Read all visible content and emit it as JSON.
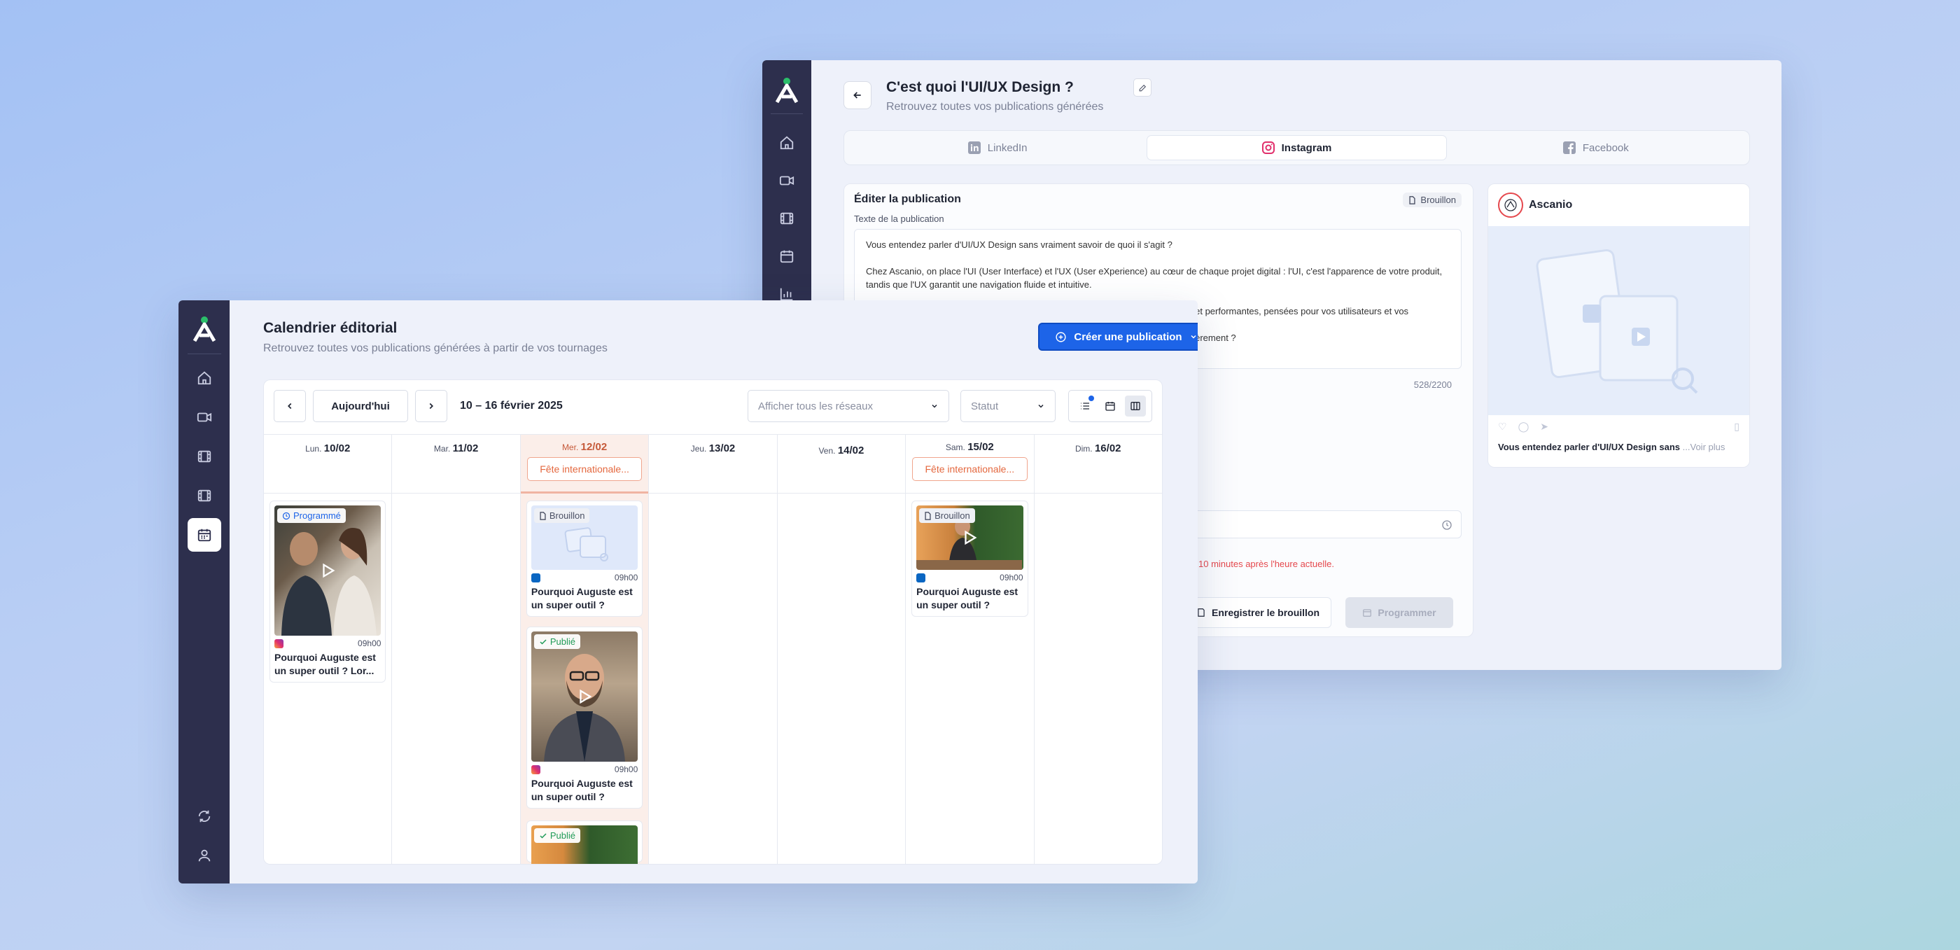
{
  "back": {
    "header_title": "C'est quoi l'UI/UX Design ?",
    "header_subtitle": "Retrouvez toutes vos publications générées",
    "tabs": [
      {
        "label": "LinkedIn",
        "active": false
      },
      {
        "label": "Instagram",
        "active": true
      },
      {
        "label": "Facebook",
        "active": false
      }
    ],
    "editor": {
      "title": "Éditer la publication",
      "status": "Brouillon",
      "text_label": "Texte de la publication",
      "text_p1": "Vous entendez parler d'UI/UX Design sans vraiment savoir de quoi il s'agit ?",
      "text_p2": "Chez Ascanio, on place l'UI (User Interface) et l'UX (User eXperience) au cœur de chaque projet digital : l'UI, c'est l'apparence de votre produit, tandis que l'UX garantit une navigation fluide et intuitive.",
      "text_p3": "s et performantes, pensées pour vos utilisateurs et vos",
      "text_p4": "nièrement ?",
      "char_count": "528/2200",
      "error_text": "10 minutes après l'heure actuelle.",
      "save_draft": "Enregistrer le brouillon",
      "schedule": "Programmer"
    },
    "preview": {
      "account": "Ascanio",
      "caption": "Vous entendez parler d'UI/UX Design sans",
      "see_more": "...Voir plus"
    }
  },
  "front": {
    "title": "Calendrier éditorial",
    "subtitle": "Retrouvez toutes vos publications générées à partir de vos tournages",
    "create_button": "Créer une publication",
    "today_button": "Aujourd'hui",
    "date_range": "10 – 16 février 2025",
    "network_placeholder": "Afficher tous les réseaux",
    "status_placeholder": "Statut",
    "days": [
      {
        "dow": "Lun.",
        "date": "10/02"
      },
      {
        "dow": "Mar.",
        "date": "11/02"
      },
      {
        "dow": "Mer.",
        "date": "12/02"
      },
      {
        "dow": "Jeu.",
        "date": "13/02"
      },
      {
        "dow": "Ven.",
        "date": "14/02"
      },
      {
        "dow": "Sam.",
        "date": "15/02"
      },
      {
        "dow": "Dim.",
        "date": "16/02"
      }
    ],
    "events": {
      "wed": "Fête internationale...",
      "sat": "Fête internationale..."
    },
    "posts": {
      "mon": {
        "status": "Programmé",
        "network": "instagram",
        "time": "09h00",
        "title": "Pourquoi Auguste est un super outil ? Lor..."
      },
      "wed1": {
        "status": "Brouillon",
        "network": "linkedin",
        "time": "09h00",
        "title": "Pourquoi Auguste est un super outil ?"
      },
      "wed2": {
        "status": "Publié",
        "network": "instagram",
        "time": "09h00",
        "title": "Pourquoi Auguste est un super outil ?"
      },
      "wed3": {
        "status": "Publié"
      },
      "sat": {
        "status": "Brouillon",
        "network": "linkedin",
        "time": "09h00",
        "title": "Pourquoi Auguste est un super outil ?"
      }
    }
  },
  "colors": {
    "sidebar": "#2d2f4d",
    "primary": "#1d64e8",
    "accent_orange": "#e4683f",
    "green": "#2bbf6a"
  }
}
